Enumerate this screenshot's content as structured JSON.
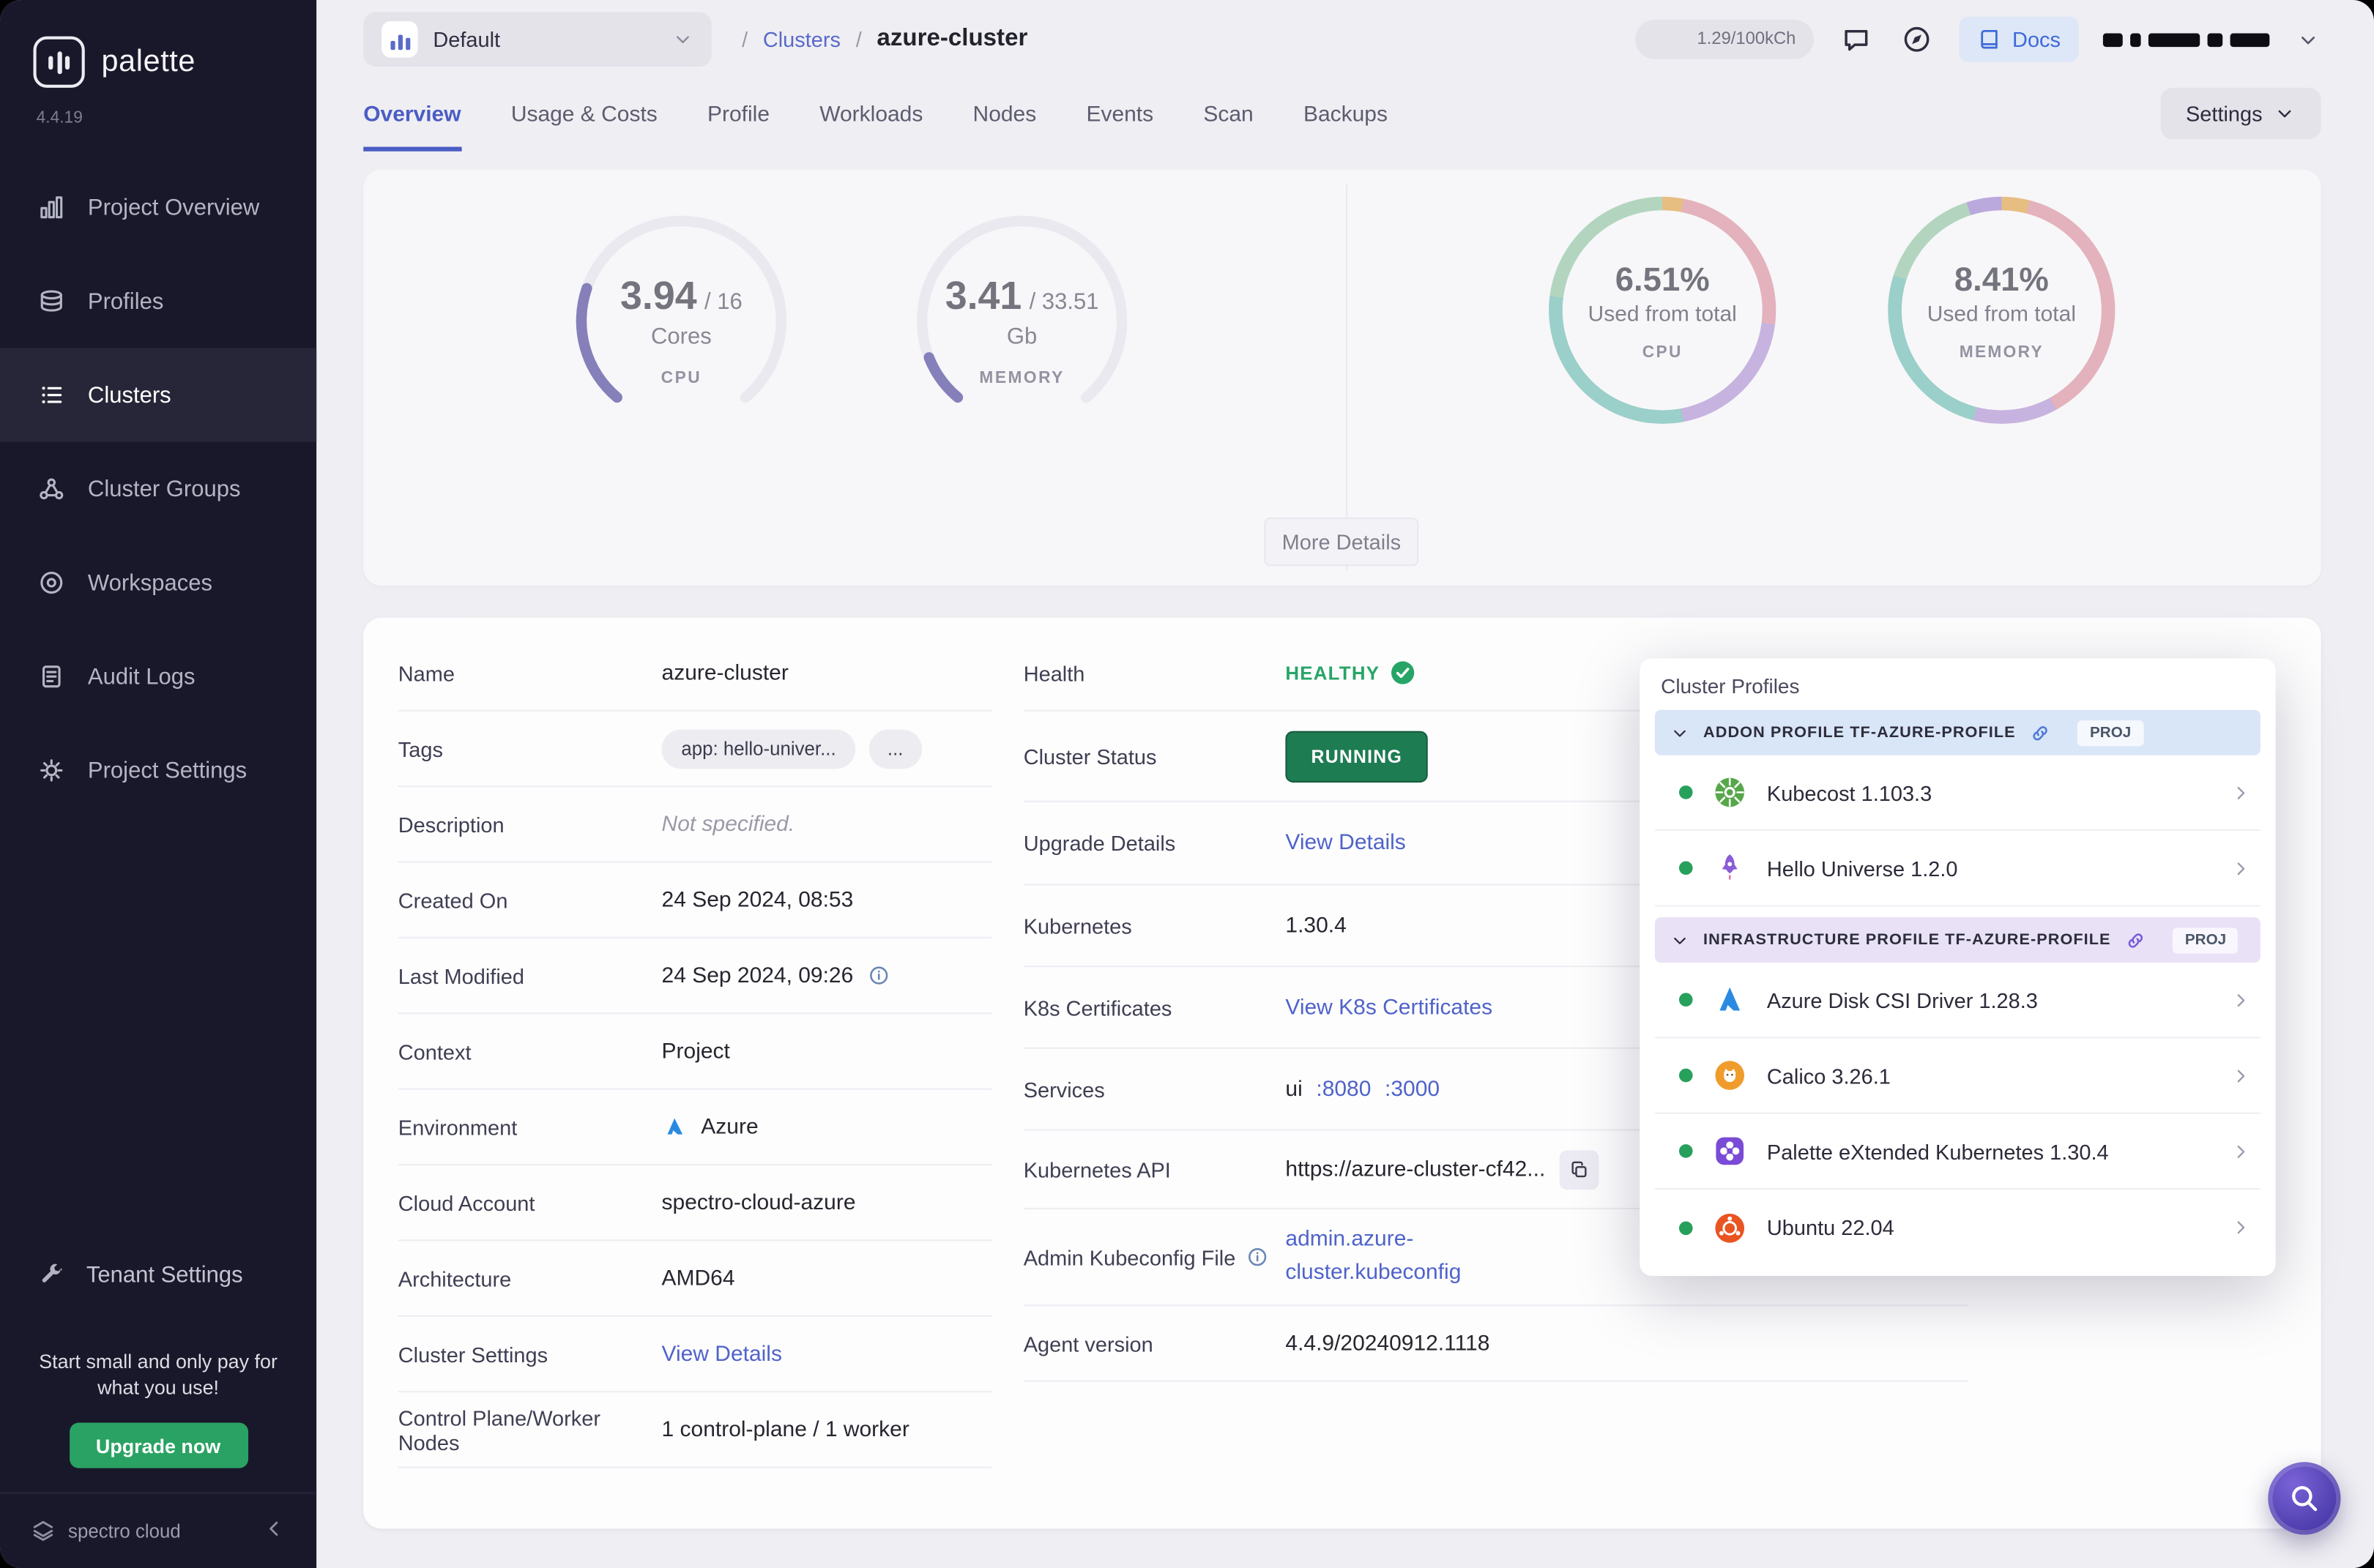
{
  "colors": {
    "accent_blue": "#4f63c9",
    "active_tab_blue": "#4b5cc4",
    "healthy_green": "#27a567",
    "running_badge_bg": "#1e7c52",
    "upgrade_green": "#2aa263",
    "gauge_purple": "#453d98",
    "sidebar_bg": "#19182a"
  },
  "sidebar": {
    "logo_text": "palette",
    "version": "4.4.19",
    "items": [
      {
        "label": "Project Overview",
        "icon": "project-overview-icon"
      },
      {
        "label": "Profiles",
        "icon": "profiles-icon"
      },
      {
        "label": "Clusters",
        "icon": "clusters-icon"
      },
      {
        "label": "Cluster Groups",
        "icon": "cluster-groups-icon"
      },
      {
        "label": "Workspaces",
        "icon": "workspaces-icon"
      },
      {
        "label": "Audit Logs",
        "icon": "audit-logs-icon"
      },
      {
        "label": "Project Settings",
        "icon": "project-settings-icon"
      }
    ],
    "active_item": "Clusters",
    "tenant_settings_label": "Tenant Settings",
    "promo_text": "Start small and only pay for what you use!",
    "upgrade_button_label": "Upgrade now",
    "brand_name": "spectro cloud"
  },
  "topbar": {
    "project_selector": "Default",
    "breadcrumb_separator": "/",
    "breadcrumb_section": "Clusters",
    "breadcrumb_current": "azure-cluster",
    "usage_pill": "1.29/100kCh",
    "docs_label": "Docs"
  },
  "tabs": {
    "labels": [
      "Overview",
      "Usage & Costs",
      "Profile",
      "Workloads",
      "Nodes",
      "Events",
      "Scan",
      "Backups"
    ],
    "active": "Overview",
    "settings_button": "Settings"
  },
  "metrics": {
    "gauges": [
      {
        "value": "3.94",
        "capacity": 16,
        "total_label": "/ 16",
        "unit": "Cores",
        "label": "CPU"
      },
      {
        "value": "3.41",
        "capacity": 33.51,
        "total_label": "/ 33.51",
        "unit": "Gb",
        "label": "MEMORY"
      }
    ],
    "donuts": [
      {
        "percent": "6.51%",
        "caption": "Used from total",
        "label": "CPU",
        "segments": [
          {
            "color": "#e2a23e",
            "frac": 0.03
          },
          {
            "color": "#dd8f9b",
            "frac": 0.24
          },
          {
            "color": "#b090d4",
            "frac": 0.2
          },
          {
            "color": "#68bdb0",
            "frac": 0.3
          },
          {
            "color": "#8fc7a0",
            "frac": 0.23
          }
        ]
      },
      {
        "percent": "8.41%",
        "caption": "Used from total",
        "label": "MEMORY",
        "segments": [
          {
            "color": "#e2a23e",
            "frac": 0.04
          },
          {
            "color": "#dd8f9b",
            "frac": 0.38
          },
          {
            "color": "#b090d4",
            "frac": 0.12
          },
          {
            "color": "#68bdb0",
            "frac": 0.26
          },
          {
            "color": "#8fc7a0",
            "frac": 0.15
          },
          {
            "color": "#9a7fd0",
            "frac": 0.05
          }
        ]
      }
    ],
    "more_details_button": "More Details"
  },
  "details": {
    "name": {
      "label": "Name",
      "value": "azure-cluster"
    },
    "tags": {
      "label": "Tags",
      "tag_pill": "app: hello-univer...",
      "more_pill": "..."
    },
    "description": {
      "label": "Description",
      "value": "Not specified."
    },
    "created_on": {
      "label": "Created On",
      "value": "24 Sep 2024, 08:53"
    },
    "last_modified": {
      "label": "Last Modified",
      "value": "24 Sep 2024, 09:26"
    },
    "context": {
      "label": "Context",
      "value": "Project"
    },
    "environment": {
      "label": "Environment",
      "value": "Azure"
    },
    "cloud_account": {
      "label": "Cloud Account",
      "value": "spectro-cloud-azure"
    },
    "architecture": {
      "label": "Architecture",
      "value": "AMD64"
    },
    "cluster_settings": {
      "label": "Cluster Settings",
      "link": "View Details"
    },
    "control_plane": {
      "label": "Control Plane/Worker Nodes",
      "value": "1 control-plane / 1 worker"
    },
    "health": {
      "label": "Health",
      "value": "HEALTHY"
    },
    "cluster_status": {
      "label": "Cluster Status",
      "value": "RUNNING"
    },
    "upgrade_details": {
      "label": "Upgrade Details",
      "link": "View Details"
    },
    "kubernetes": {
      "label": "Kubernetes",
      "value": "1.30.4"
    },
    "k8s_certificates": {
      "label": "K8s Certificates",
      "link": "View K8s Certificates"
    },
    "services": {
      "label": "Services",
      "name": "ui",
      "ports": [
        ":8080",
        ":3000"
      ]
    },
    "kubernetes_api": {
      "label": "Kubernetes API",
      "value": "https://azure-cluster-cf42..."
    },
    "admin_kubeconfig": {
      "label": "Admin Kubeconfig File",
      "link_line1": "admin.azure-",
      "link_line2": "cluster.kubeconfig"
    },
    "agent_version": {
      "label": "Agent version",
      "value": "4.4.9/20240912.1118"
    }
  },
  "cluster_profiles": {
    "title": "Cluster Profiles",
    "sections": [
      {
        "type": "addon",
        "name": "ADDON PROFILE TF-AZURE-PROFILE",
        "badge": "PROJ",
        "items": [
          {
            "label": "Kubecost 1.103.3",
            "icon": "kubecost-icon"
          },
          {
            "label": "Hello Universe 1.2.0",
            "icon": "hello-universe-icon"
          }
        ]
      },
      {
        "type": "infrastructure",
        "name": "INFRASTRUCTURE PROFILE TF-AZURE-PROFILE",
        "badge": "PROJ",
        "items": [
          {
            "label": "Azure Disk CSI Driver 1.28.3",
            "icon": "azure-icon"
          },
          {
            "label": "Calico 3.26.1",
            "icon": "calico-icon"
          },
          {
            "label": "Palette eXtended Kubernetes 1.30.4",
            "icon": "pxk-icon"
          },
          {
            "label": "Ubuntu 22.04",
            "icon": "ubuntu-icon"
          }
        ]
      }
    ]
  }
}
